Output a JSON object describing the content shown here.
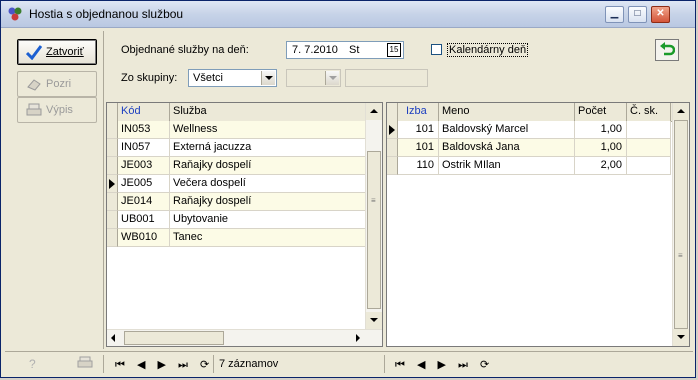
{
  "window": {
    "title": "Hostia s objednanou službou"
  },
  "toolbar": {
    "close_label": "Zatvoriť",
    "view_label": "Pozri",
    "print_label": "Výpis"
  },
  "filters": {
    "date_label": "Objednané služby na deň:",
    "date_value": "7. 7.2010",
    "day_value": "St",
    "calendar_btn": "15",
    "calendar_days_label": "Kalendárny deň",
    "group_label": "Zo skupiny:",
    "group_value": "Všetci",
    "subgroup_value": "",
    "extra_value": ""
  },
  "services": {
    "columns": [
      "Kód",
      "Služba"
    ],
    "rows": [
      {
        "code": "IN053",
        "name": "Wellness"
      },
      {
        "code": "IN057",
        "name": "Externá jacuzza"
      },
      {
        "code": "JE003",
        "name": "Raňajky dospelí"
      },
      {
        "code": "JE005",
        "name": "Večera dospelí"
      },
      {
        "code": "JE014",
        "name": "Raňajky dospelí"
      },
      {
        "code": "UB001",
        "name": "Ubytovanie"
      },
      {
        "code": "WB010",
        "name": "Tanec"
      }
    ],
    "current_row": 3
  },
  "guests": {
    "columns": [
      "Izba",
      "Meno",
      "Počet",
      "Č. sk."
    ],
    "rows": [
      {
        "room": "101",
        "name": "Baldovský Marcel",
        "count": "1,00",
        "group": ""
      },
      {
        "room": "101",
        "name": "Baldovská Jana",
        "count": "1,00",
        "group": ""
      },
      {
        "room": "110",
        "name": "Ostrik MIlan",
        "count": "2,00",
        "group": ""
      }
    ],
    "current_row": 0
  },
  "status": {
    "records": "7 záznamov",
    "nav_first": "⏮",
    "nav_prev": "◀",
    "nav_next": "▶",
    "nav_last": "⏭",
    "nav_refresh": "⟳"
  },
  "colors": {
    "accent_blue": "#1c3fc0",
    "row_alt": "#fcfbe6",
    "check_blue": "#1c5fd1",
    "back_green": "#1a9b2a"
  }
}
